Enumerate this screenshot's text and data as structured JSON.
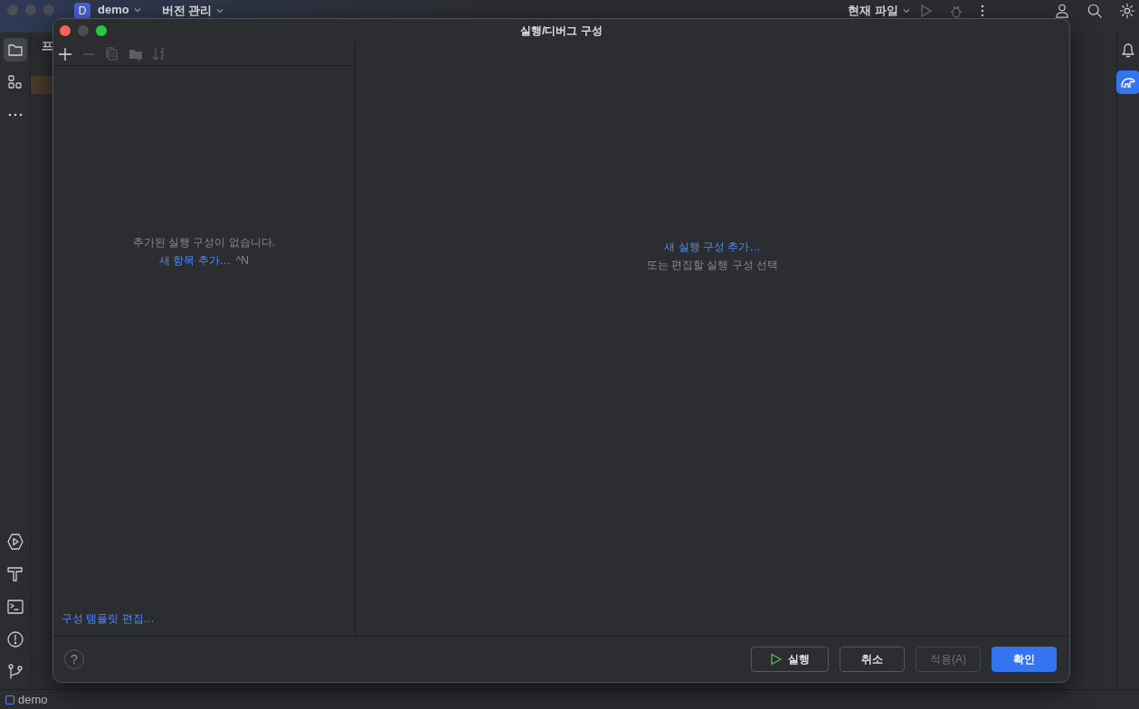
{
  "ide": {
    "project": {
      "badge": "D",
      "name": "demo"
    },
    "vcs_menu": "버전 관리",
    "run_target": "현재 파일",
    "panel_title": "프",
    "left_tools": [
      {
        "kind": "folder",
        "selected": true
      },
      {
        "kind": "structure",
        "selected": false
      },
      {
        "kind": "more",
        "selected": false
      }
    ],
    "bottom_tools": [
      {
        "kind": "run"
      },
      {
        "kind": "build"
      },
      {
        "kind": "terminal"
      },
      {
        "kind": "problems"
      },
      {
        "kind": "git"
      }
    ],
    "right_tools": [
      {
        "kind": "bell",
        "selected": false
      },
      {
        "kind": "gradle",
        "selected": true
      }
    ]
  },
  "dialog": {
    "title": "실행/디버그 구성",
    "toolbar": [
      {
        "kind": "add",
        "disabled": false
      },
      {
        "kind": "remove",
        "disabled": true
      },
      {
        "kind": "copy",
        "disabled": true
      },
      {
        "kind": "folder",
        "disabled": true
      },
      {
        "kind": "sort",
        "disabled": true
      }
    ],
    "left_empty": {
      "message": "추가된 실행 구성이 없습니다.",
      "link": "새 항목 추가…",
      "shortcut": "^N"
    },
    "edit_templates": "구성 템플릿 편집…",
    "right_empty": {
      "link": "새 실행 구성 추가…",
      "hint": "또는 편집할 실행 구성 선택"
    },
    "buttons": [
      {
        "label": "실행",
        "kind": "run",
        "disabled": false
      },
      {
        "label": "취소",
        "kind": "normal",
        "disabled": false
      },
      {
        "label": "적용(A)",
        "kind": "normal",
        "disabled": true
      },
      {
        "label": "확인",
        "kind": "primary",
        "disabled": false
      }
    ]
  },
  "help": "?",
  "status_bar": {
    "project": "demo"
  }
}
